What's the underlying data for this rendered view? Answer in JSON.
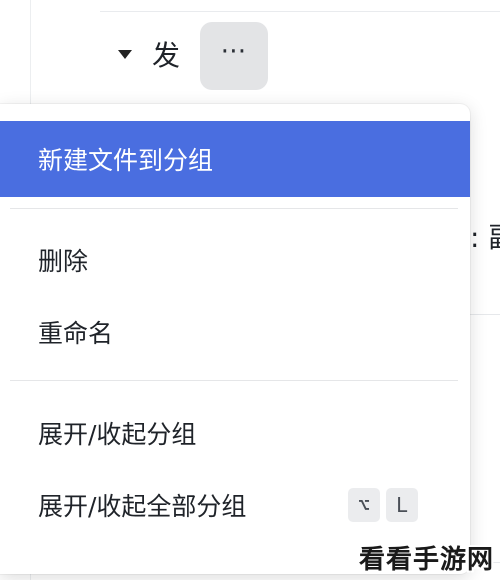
{
  "group": {
    "label": "发",
    "more_label": "⋯"
  },
  "background": {
    "right_snippet": ": 副"
  },
  "menu": {
    "items": [
      {
        "label": "新建文件到分组"
      },
      {
        "label": "删除"
      },
      {
        "label": "重命名"
      },
      {
        "label": "展开/收起分组"
      },
      {
        "label": "展开/收起全部分组"
      }
    ],
    "shortcut": [
      "⌥",
      "L"
    ],
    "active_color": "#4a6ee0"
  },
  "watermark": "看看手游网"
}
